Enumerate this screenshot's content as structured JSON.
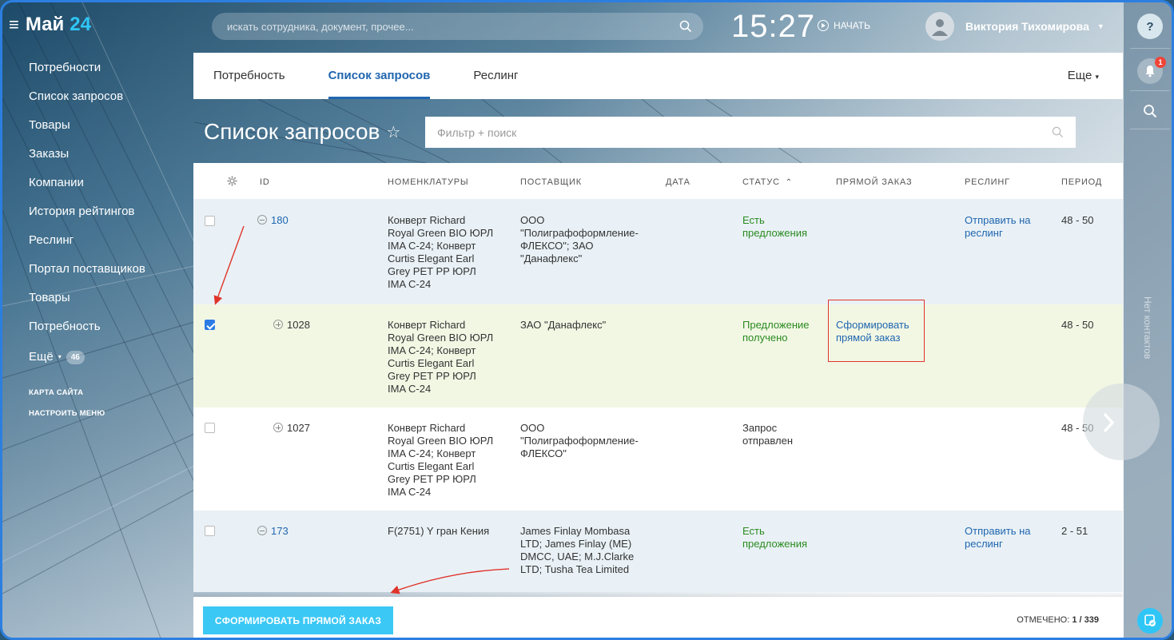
{
  "header": {
    "logo_text": "Май",
    "logo_number": "24",
    "search_placeholder": "искать сотрудника, документ, прочее...",
    "clock": "15:27",
    "start_label": "НАЧАТЬ",
    "user_name": "Виктория Тихомирова"
  },
  "sidebar": {
    "items": [
      {
        "label": "Потребности"
      },
      {
        "label": "Список запросов"
      },
      {
        "label": "Товары"
      },
      {
        "label": "Заказы"
      },
      {
        "label": "Компании"
      },
      {
        "label": "История рейтингов"
      },
      {
        "label": "Реслинг"
      },
      {
        "label": "Портал поставщиков"
      },
      {
        "label": "Товары"
      },
      {
        "label": "Потребность"
      }
    ],
    "more_label": "Ещё",
    "more_count": "46",
    "site_map": "КАРТА САЙТА",
    "configure_menu": "НАСТРОИТЬ МЕНЮ"
  },
  "right_strip": {
    "help": "?",
    "notifications_count": "1",
    "no_contacts": "Нет контактов"
  },
  "tabs": {
    "items": [
      {
        "label": "Потребность"
      },
      {
        "label": "Список запросов"
      },
      {
        "label": "Реслинг"
      }
    ],
    "active_index": 1,
    "more_label": "Еще"
  },
  "page": {
    "title": "Список запросов",
    "filter_placeholder": "Фильтр + поиск"
  },
  "table": {
    "columns": [
      "ID",
      "НОМЕНКЛАТУРЫ",
      "ПОСТАВЩИК",
      "ДАТА",
      "СТАТУС",
      "ПРЯМОЙ ЗАКАЗ",
      "РЕСЛИНГ",
      "ПЕРИОД"
    ],
    "rows": [
      {
        "id": "180",
        "checked": false,
        "nomenclature": [
          "Конверт Richard",
          "Royal Green BIO ЮРЛ",
          "IMA C-24; Конверт",
          "Curtis Elegant Earl",
          "Grey PET PP ЮРЛ",
          "IMA C-24"
        ],
        "supplier": [
          "ООО",
          "\"Полиграфоформление-",
          "ФЛЕКСО\"; ЗАО",
          "\"Данафлекс\""
        ],
        "date": "",
        "status": [
          "Есть",
          "предложения"
        ],
        "direct_order": [],
        "wrestling": [
          "Отправить на",
          "реслинг"
        ],
        "period": "48 - 50"
      },
      {
        "id": "1028",
        "checked": true,
        "nomenclature": [
          "Конверт Richard",
          "Royal Green BIO ЮРЛ",
          "IMA C-24; Конверт",
          "Curtis Elegant Earl",
          "Grey PET PP ЮРЛ",
          "IMA C-24"
        ],
        "supplier": [
          "ЗАО \"Данафлекс\""
        ],
        "date": "",
        "status": [
          "Предложение",
          "получено"
        ],
        "direct_order": [
          "Сформировать",
          "прямой заказ"
        ],
        "wrestling": [],
        "period": "48 - 50"
      },
      {
        "id": "1027",
        "checked": false,
        "nomenclature": [
          "Конверт Richard",
          "Royal Green BIO ЮРЛ",
          "IMA C-24; Конверт",
          "Curtis Elegant Earl",
          "Grey PET PP ЮРЛ",
          "IMA C-24"
        ],
        "supplier": [
          "ООО",
          "\"Полиграфоформление-",
          "ФЛЕКСО\""
        ],
        "date": "",
        "status": [
          "Запрос",
          "отправлен"
        ],
        "direct_order": [],
        "wrestling": [],
        "period": "48 - 50"
      },
      {
        "id": "173",
        "checked": false,
        "nomenclature": [
          "F(2751) Y гран Кения"
        ],
        "supplier": [
          "James Finlay Mombasa",
          "LTD; James Finlay (ME)",
          "DMCC, UAE; M.J.Clarke",
          "LTD; Tusha Tea Limited"
        ],
        "date": "",
        "status": [
          "Есть",
          "предложения"
        ],
        "direct_order": [],
        "wrestling": [
          "Отправить на",
          "реслинг"
        ],
        "period": "2 - 51"
      }
    ]
  },
  "footer": {
    "action_button": "СФОРМИРОВАТЬ ПРЯМОЙ ЗАКАЗ",
    "selected_label": "ОТМЕЧЕНО:",
    "selected_value": "1 / 339"
  },
  "colors": {
    "accent": "#2066b0",
    "button": "#3bc8f5",
    "status_green": "#2a8a1f",
    "highlight_red": "#e0342b",
    "row_blue": "#e9f1f6",
    "row_yellow": "#f2f7e4"
  }
}
